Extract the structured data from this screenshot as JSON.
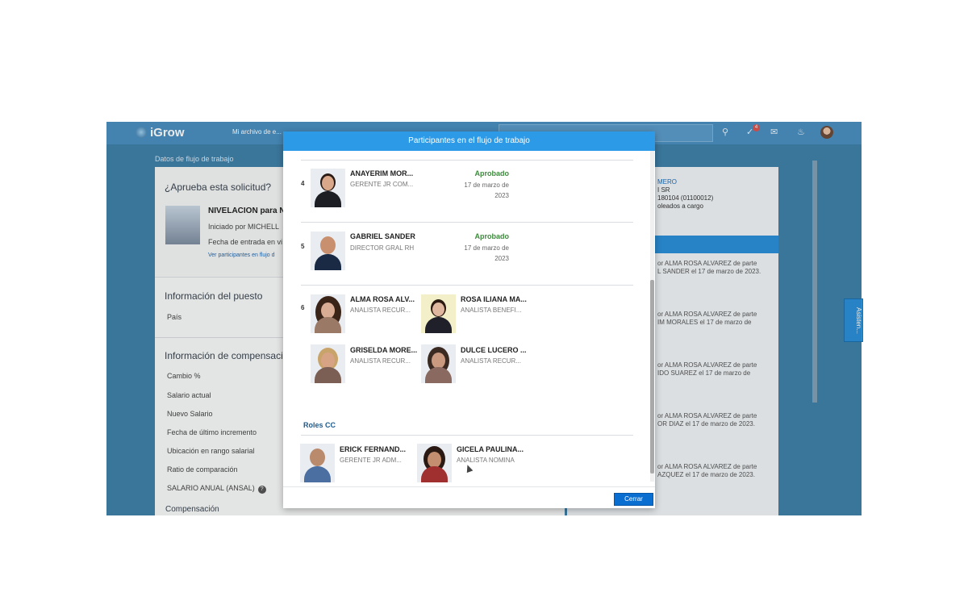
{
  "app": {
    "logo": "iGrow",
    "nav_menu": "Mi archivo de e...",
    "notification_count": "4",
    "subtitle": "Datos de flujo de trabajo"
  },
  "left": {
    "question": "¿Aprueba esta solicitud?",
    "request_title": "NIVELACION para N",
    "initiated_by": "Iniciado por MICHELL",
    "entry_date": "Fecha de entrada en vi",
    "participants_link": "Ver participantes en flujo d",
    "position_title": "Información del puesto",
    "country_label": "País",
    "compensation_title": "Información de compensació",
    "rows": [
      "Cambio %",
      "Salario actual",
      "Nuevo Salario",
      "Fecha de último incremento",
      "Ubicación en rango salarial",
      "Ratio de comparación",
      "SALARIO ANUAL (ANSAL)"
    ],
    "compensation_sub": "Compensación"
  },
  "right": {
    "header_lines": [
      "MERO",
      "I SR",
      "180104 (01100012)",
      "oleados a cargo"
    ],
    "activity": [
      [
        "or ALMA ROSA ALVAREZ de parte",
        "L SANDER el 17 de marzo de 2023."
      ],
      [
        "or ALMA ROSA ALVAREZ de parte",
        "IM MORALES el 17 de marzo de"
      ],
      [
        "or ALMA ROSA ALVAREZ de parte",
        "IDO SUAREZ el 17 de marzo de"
      ],
      [
        "or ALMA ROSA ALVAREZ de parte",
        "OR DIAZ el 17 de marzo de 2023."
      ],
      [
        "or ALMA ROSA ALVAREZ de parte",
        "AZQUEZ el 17 de marzo de 2023."
      ]
    ],
    "assist_tab": "Asisten..."
  },
  "modal": {
    "title": "Participantes en el flujo de trabajo",
    "steps": [
      {
        "number": "4",
        "name": "ANAYERIM MOR...",
        "role": "GERENTE JR COM...",
        "status": "Aprobado",
        "date_lines": [
          "17 de marzo de",
          "2023"
        ]
      },
      {
        "number": "5",
        "name": "GABRIEL SANDER",
        "role": "DIRECTOR GRAL RH",
        "status": "Aprobado",
        "date_lines": [
          "17 de marzo de",
          "2023"
        ]
      }
    ],
    "step6": {
      "number": "6",
      "people": [
        {
          "name": "ALMA ROSA ALV...",
          "role": "ANALISTA RECUR..."
        },
        {
          "name": "ROSA ILIANA MA...",
          "role": "ANALISTA BENEFI..."
        },
        {
          "name": "GRISELDA MORE...",
          "role": "ANALISTA RECUR..."
        },
        {
          "name": "DULCE LUCERO ...",
          "role": "ANALISTA RECUR..."
        }
      ]
    },
    "roles_cc_label": "Roles CC",
    "roles_cc": [
      {
        "name": "ERICK FERNAND...",
        "role": "GERENTE JR ADM..."
      },
      {
        "name": "GICELA PAULINA...",
        "role": "ANALISTA NOMINA"
      }
    ],
    "close_label": "Cerrar"
  }
}
